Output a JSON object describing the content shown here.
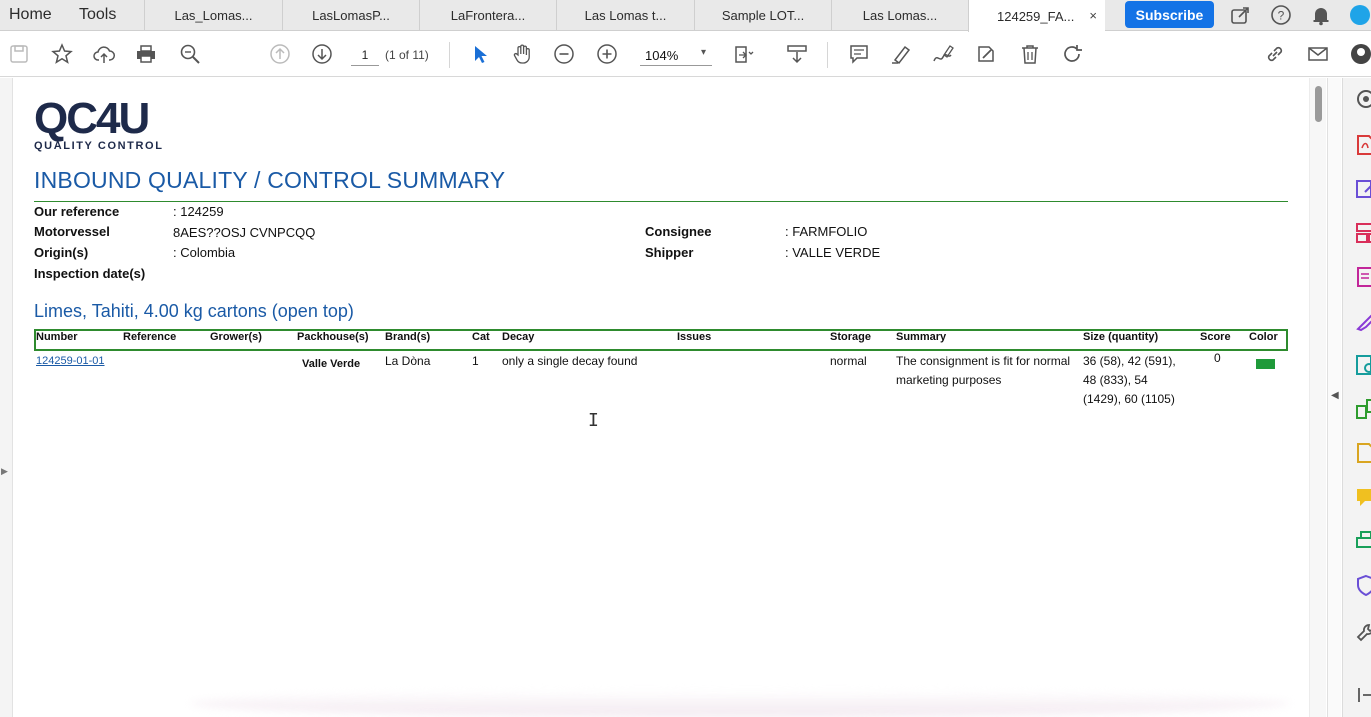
{
  "tabbar": {
    "home_label": "Home",
    "tools_label": "Tools",
    "tabs": [
      {
        "label": "Las_Lomas..."
      },
      {
        "label": "LasLomasP..."
      },
      {
        "label": "LaFrontera..."
      },
      {
        "label": "Las Lomas t..."
      },
      {
        "label": "Sample LOT..."
      },
      {
        "label": "Las Lomas..."
      },
      {
        "label": "124259_FA...",
        "active": true
      }
    ],
    "close_glyph": "×",
    "subscribe_label": "Subscribe",
    "icons": [
      "share-icon",
      "help-icon",
      "notification-bell-icon",
      "account-avatar-icon"
    ]
  },
  "toolbar": {
    "icons": [
      "save-icon",
      "bookmark-star-icon",
      "upload-cloud-icon",
      "print-icon",
      "zoom-search-icon",
      "page-up-icon",
      "page-down-icon",
      "select-arrow-icon",
      "hand-tool-icon",
      "zoom-out-icon",
      "zoom-in-icon",
      "fit-page-icon",
      "scroll-mode-icon",
      "comment-icon",
      "highlight-icon",
      "sign-icon",
      "edit-icon",
      "delete-icon",
      "rotate-icon",
      "link-icon",
      "email-icon",
      "user-icon"
    ],
    "page_value": "1",
    "page_count": "(1 of 11)",
    "zoom_value": "104%",
    "zoom_caret": "▾"
  },
  "document": {
    "logo_text": "QC4U",
    "logo_subtitle": "QUALITY CONTROL",
    "title": "INBOUND QUALITY / CONTROL SUMMARY",
    "fields": {
      "our_reference_label": "Our reference",
      "our_reference_value": ":  124259",
      "motorvessel_label": "Motorvessel",
      "motorvessel_value": "8AES??OSJ CVNPCQQ",
      "origin_label": "Origin(s)",
      "origin_value": ":  Colombia",
      "inspection_label": "Inspection date(s)",
      "consignee_label": "Consignee",
      "consignee_value": ":  FARMFOLIO",
      "shipper_label": "Shipper",
      "shipper_value": ":  VALLE VERDE"
    },
    "product_title": "Limes, Tahiti, 4.00 kg cartons (open top)",
    "table": {
      "headers": [
        "Number",
        "Reference",
        "Grower(s)",
        "Packhouse(s)",
        "Brand(s)",
        "Cat",
        "Decay",
        "Issues",
        "Storage",
        "Summary",
        "Size (quantity)",
        "Score",
        "Color"
      ],
      "rows": [
        {
          "number": "124259-01-01",
          "reference": "",
          "grower": "",
          "packhouse": "Valle Verde",
          "brand": "La Dòna",
          "cat": "1",
          "decay": "only a single decay found",
          "issues": "",
          "storage": "normal",
          "summary_line1": "The consignment is fit for normal",
          "summary_line2": "marketing purposes",
          "size_line1": "36 (58), 42 (591),",
          "size_line2": "48 (833), 54",
          "size_line3": "(1429), 60 (1105)",
          "score": "0",
          "color": "#1f9a3a"
        }
      ]
    }
  },
  "colors": {
    "accent_blue": "#1a5aa6",
    "rule_green": "#2e8b2e",
    "subscribe_blue": "#1473e6"
  }
}
